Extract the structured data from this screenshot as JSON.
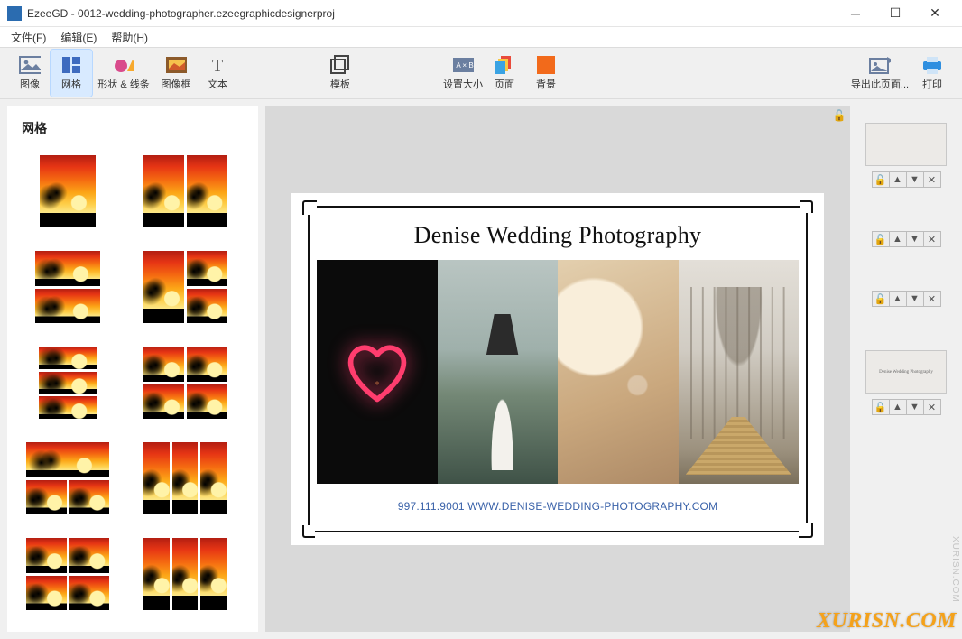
{
  "window": {
    "app": "EzeeGD",
    "title": "EzeeGD - 0012-wedding-photographer.ezeegraphicdesignerproj"
  },
  "menu": {
    "file": "文件(F)",
    "edit": "编辑(E)",
    "help": "帮助(H)"
  },
  "toolbar": {
    "image": "图像",
    "grid": "网格",
    "shapes": "形状 & 线条",
    "frame": "图像框",
    "text": "文本",
    "template": "模板",
    "setsize": "设置大小",
    "page": "页面",
    "background": "背景",
    "export": "导出此页面...",
    "print": "打印"
  },
  "sidebar": {
    "title": "网格"
  },
  "card": {
    "title": "Denise Wedding Photography",
    "contact": "997.111.9001 WWW.DENISE-WEDDING-PHOTOGRAPHY.COM"
  },
  "layers": {
    "thumb_text": "Denise Wedding Photography",
    "btn_lock": "🔓",
    "btn_up": "▲",
    "btn_down": "▼",
    "btn_del": "✕"
  },
  "watermark": {
    "main": "XURISN.COM",
    "side": "XURISN.COM"
  }
}
